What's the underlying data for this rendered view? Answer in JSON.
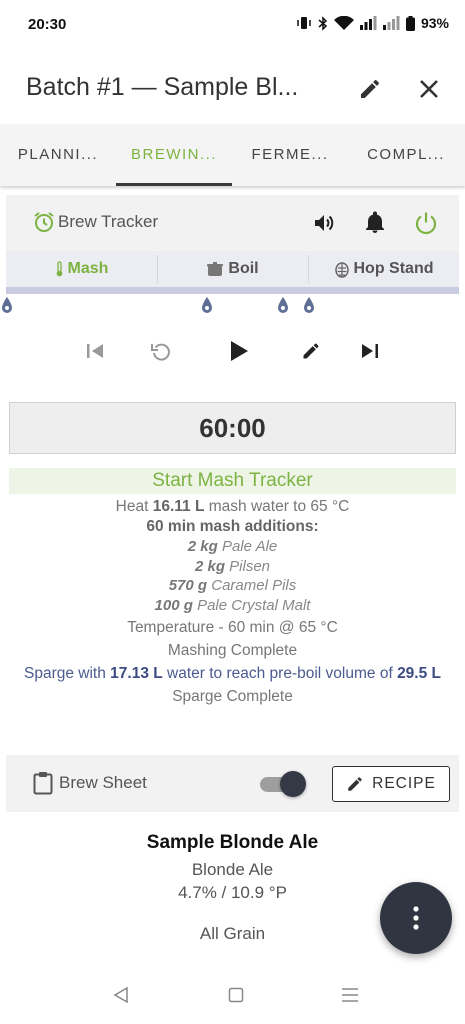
{
  "status_bar": {
    "time": "20:30",
    "battery": "93%"
  },
  "app_bar": {
    "title": "Batch #1 — Sample Bl...",
    "edit_icon": "pencil-icon",
    "close_icon": "close-icon"
  },
  "tabs": [
    {
      "label": "PLANNI...",
      "active": false
    },
    {
      "label": "BREWIN...",
      "active": true
    },
    {
      "label": "FERME...",
      "active": false
    },
    {
      "label": "COMPL...",
      "active": false
    }
  ],
  "brew_tracker": {
    "title": "Brew Tracker",
    "icons": [
      "alarm-clock-icon",
      "volume-icon",
      "bell-icon",
      "power-icon"
    ],
    "stages": [
      {
        "label": "Mash",
        "icon": "thermometer-icon",
        "active": true
      },
      {
        "label": "Boil",
        "icon": "pot-icon",
        "active": false
      },
      {
        "label": "Hop Stand",
        "icon": "hop-icon",
        "active": false
      }
    ]
  },
  "controls": [
    "skip-previous-icon",
    "restart-icon",
    "play-icon",
    "pencil-icon",
    "skip-next-icon"
  ],
  "timer": "60:00",
  "steps": {
    "start_label": "Start Mash Tracker",
    "heat": {
      "pre": "Heat ",
      "amount": "16.11 L",
      "post": " mash water to 65 °C"
    },
    "additions_header": "60 min mash additions:",
    "additions": [
      {
        "amount": "2 kg",
        "name": "Pale Ale"
      },
      {
        "amount": "2 kg",
        "name": "Pilsen"
      },
      {
        "amount": "570 g",
        "name": "Caramel Pils"
      },
      {
        "amount": "100 g",
        "name": "Pale Crystal Malt"
      }
    ],
    "temperature": "Temperature - 60 min @ 65 °C",
    "mashing_complete": "Mashing Complete",
    "sparge": {
      "pre": "Sparge with ",
      "amount": "17.13 L",
      "mid": " water to reach pre-boil volume of ",
      "volume": "29.5 L"
    },
    "sparge_complete": "Sparge Complete"
  },
  "brew_sheet": {
    "label": "Brew Sheet",
    "toggle_on": true,
    "recipe_button": "RECIPE"
  },
  "recipe": {
    "name": "Sample Blonde Ale",
    "style": "Blonde Ale",
    "stats": "4.7% / 10.9 °P",
    "type": "All Grain"
  },
  "colors": {
    "accent_green": "#7cb342",
    "sparge_blue": "#4b5a8f",
    "fab": "#2f3541"
  }
}
